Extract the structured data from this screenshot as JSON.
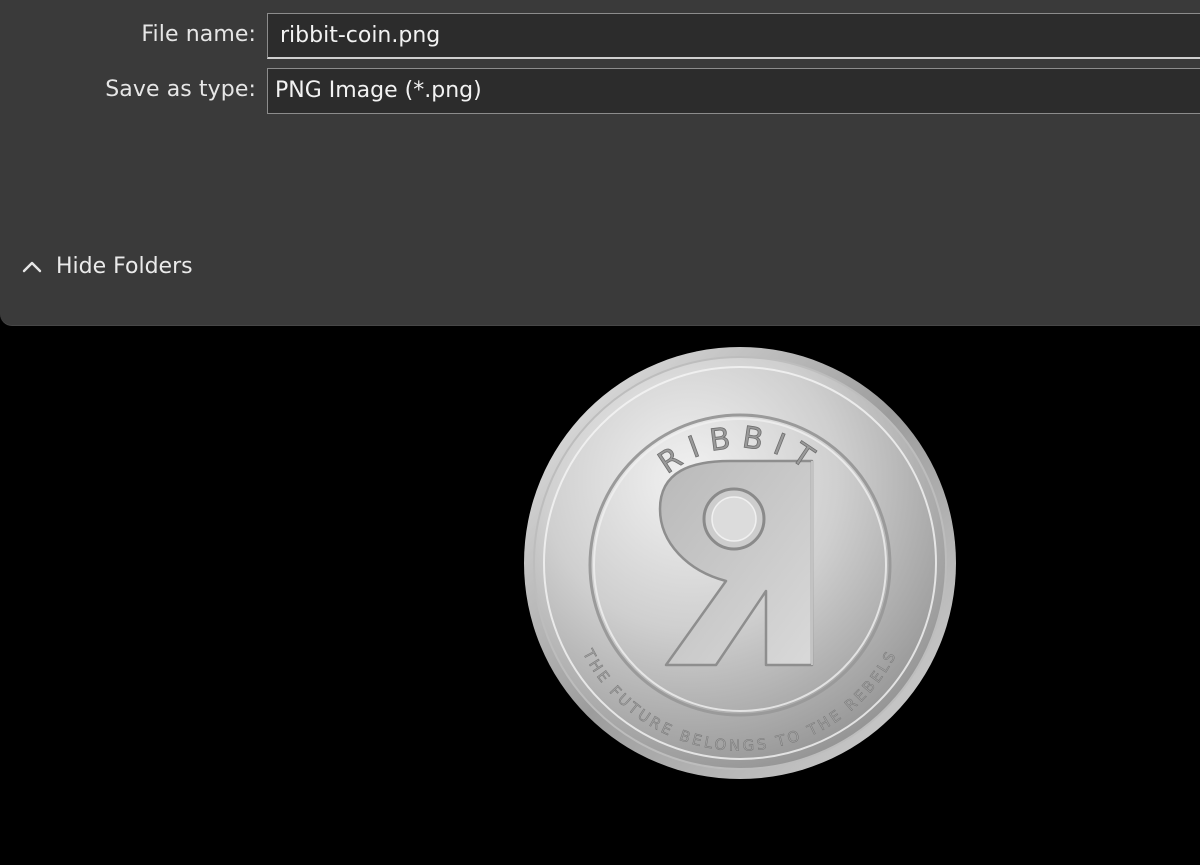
{
  "save_dialog": {
    "file_name": {
      "label": "File name:",
      "value": "ribbit-coin.png"
    },
    "save_as_type": {
      "label": "Save as type:",
      "value": "PNG Image (*.png)"
    },
    "hide_folders": {
      "label": "Hide Folders",
      "icon": "chevron-up-icon"
    }
  },
  "background_image": {
    "coin_top_text": "RIBBIT",
    "coin_bottom_text": "THE FUTURE BELONGS TO THE REBELS",
    "coin_center_glyph": "Я"
  },
  "colors": {
    "dialog_background": "#3a3a3a",
    "field_background": "#2c2c2c",
    "field_border": "#8c8c8c",
    "text": "#e6e6e6",
    "desktop_background": "#000000"
  }
}
